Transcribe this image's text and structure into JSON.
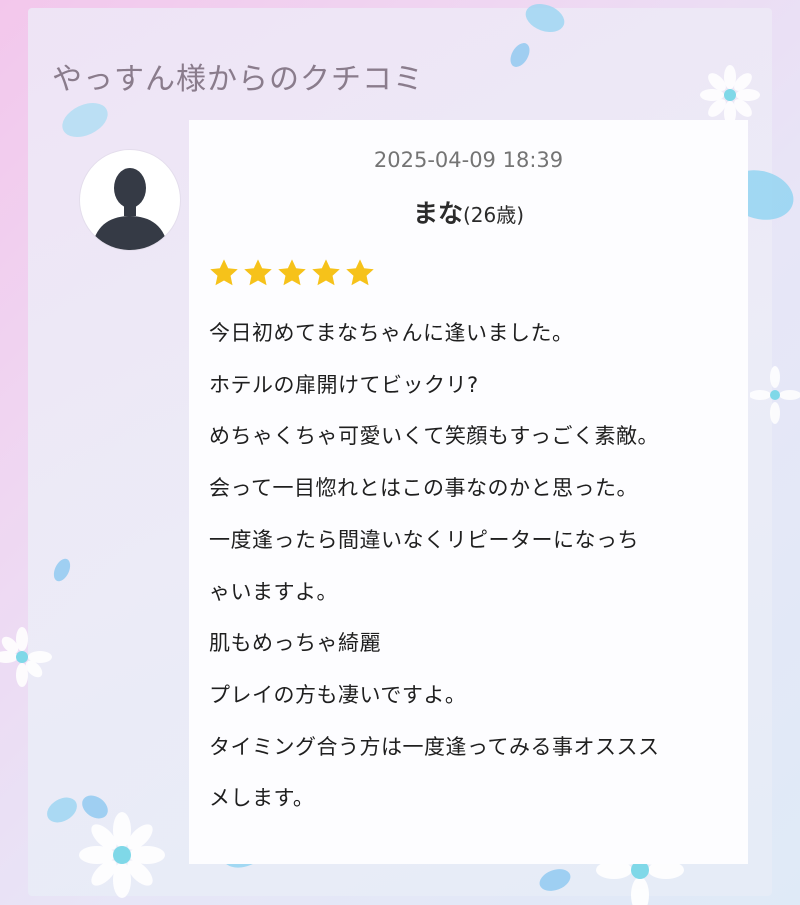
{
  "header": {
    "title": "やっすん様からのクチコミ"
  },
  "review": {
    "date": "2025-04-09 18:39",
    "name": "まな",
    "age": "(26歳)",
    "rating": 5,
    "max_rating": 5,
    "lines": [
      "今日初めてまなちゃんに逢いました。",
      "ホテルの扉開けてビックリ?",
      "めちゃくちゃ可愛いくて笑顔もすっごく素敵。",
      "会って一目惚れとはこの事なのかと思った。",
      "一度逢ったら間違いなくリピーターになっち",
      "ゃいますよ。",
      "肌もめっちゃ綺麗",
      "プレイの方も凄いですよ。",
      "タイミング合う方は一度逢ってみる事オススス",
      "メします。"
    ]
  },
  "icons": {
    "avatar": "user-silhouette-icon",
    "star": "star-icon"
  },
  "colors": {
    "star": "#f6c21a",
    "heading": "#8a7c8c",
    "card": "#fdfdff",
    "avatar_figure": "#353a45"
  }
}
